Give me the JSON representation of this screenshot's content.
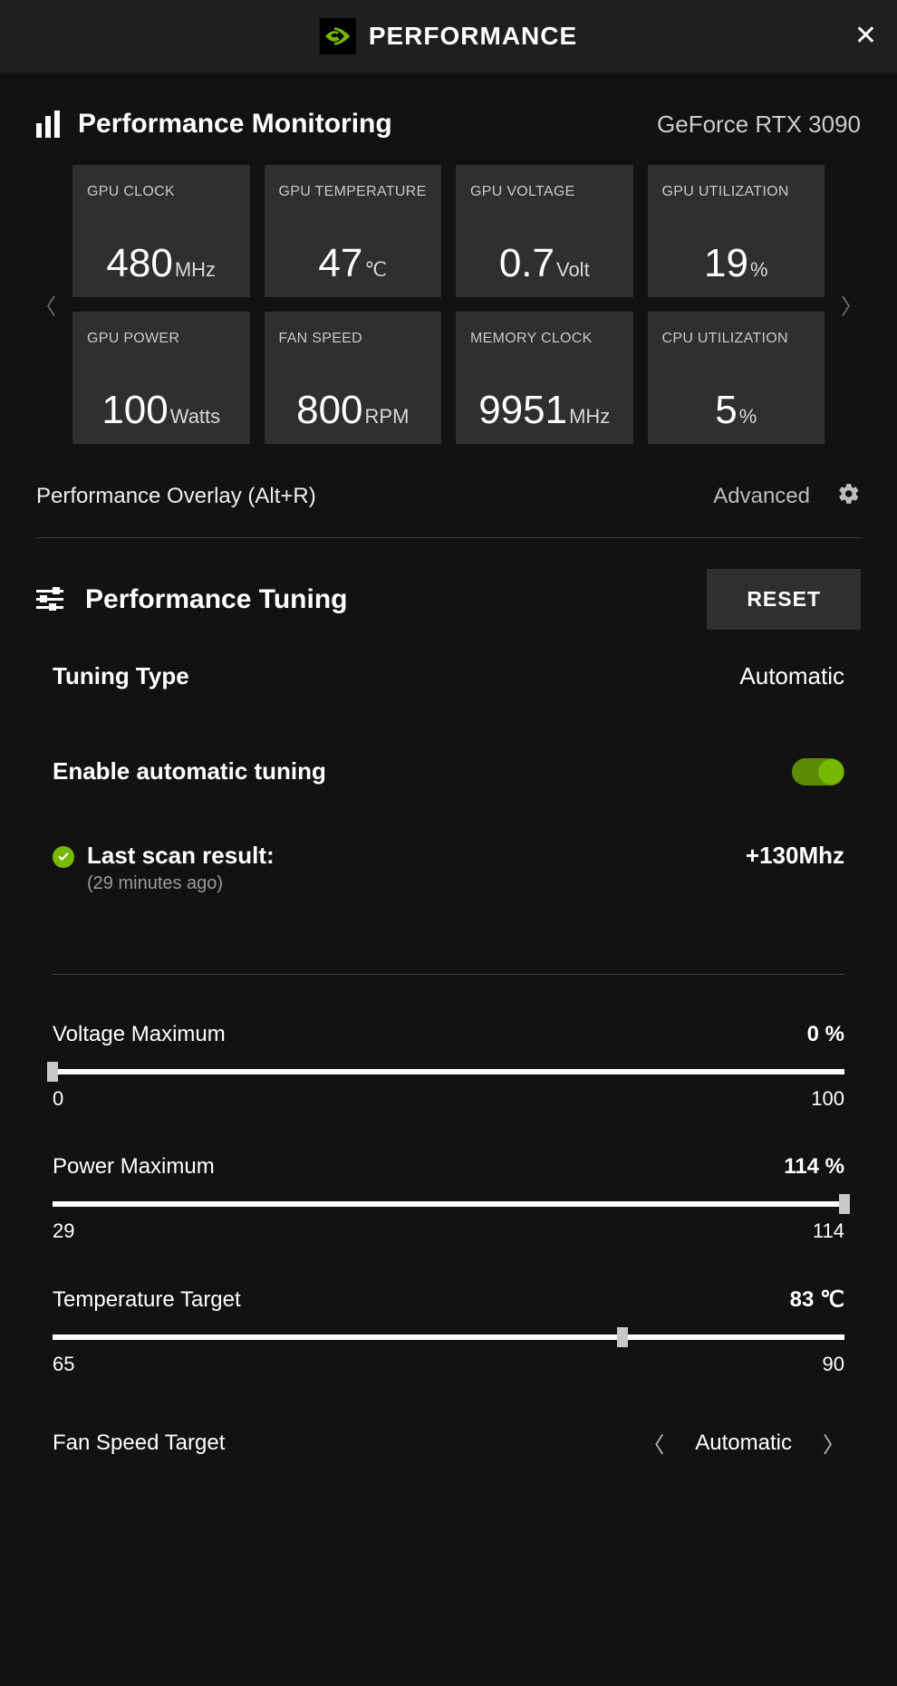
{
  "header": {
    "title": "PERFORMANCE"
  },
  "monitoring": {
    "title": "Performance Monitoring",
    "gpu_name": "GeForce RTX 3090",
    "tiles": [
      {
        "label": "GPU CLOCK",
        "value": "480",
        "unit": "MHz"
      },
      {
        "label": "GPU TEMPERATURE",
        "value": "47",
        "unit": "℃"
      },
      {
        "label": "GPU VOLTAGE",
        "value": "0.7",
        "unit": "Volt"
      },
      {
        "label": "GPU UTILIZATION",
        "value": "19",
        "unit": "%"
      },
      {
        "label": "GPU POWER",
        "value": "100",
        "unit": "Watts"
      },
      {
        "label": "FAN SPEED",
        "value": "800",
        "unit": "RPM"
      },
      {
        "label": "MEMORY CLOCK",
        "value": "9951",
        "unit": "MHz"
      },
      {
        "label": "CPU UTILIZATION",
        "value": "5",
        "unit": "%"
      }
    ]
  },
  "overlay": {
    "label": "Performance Overlay (Alt+R)",
    "advanced": "Advanced"
  },
  "tuning": {
    "title": "Performance Tuning",
    "reset_label": "RESET",
    "type_label": "Tuning Type",
    "type_value": "Automatic",
    "auto_label": "Enable automatic tuning",
    "auto_enabled": true,
    "scan": {
      "title": "Last scan result:",
      "subtitle": "(29 minutes ago)",
      "value": "+130Mhz"
    },
    "sliders": {
      "voltage": {
        "label": "Voltage Maximum",
        "display": "0 %",
        "min": "0",
        "max": "100",
        "value": 0,
        "range_min": 0,
        "range_max": 100
      },
      "power": {
        "label": "Power Maximum",
        "display": "114 %",
        "min": "29",
        "max": "114",
        "value": 114,
        "range_min": 29,
        "range_max": 114
      },
      "temp": {
        "label": "Temperature Target",
        "display": "83 ℃",
        "min": "65",
        "max": "90",
        "value": 83,
        "range_min": 65,
        "range_max": 90
      }
    },
    "fan": {
      "label": "Fan Speed Target",
      "value": "Automatic"
    }
  }
}
